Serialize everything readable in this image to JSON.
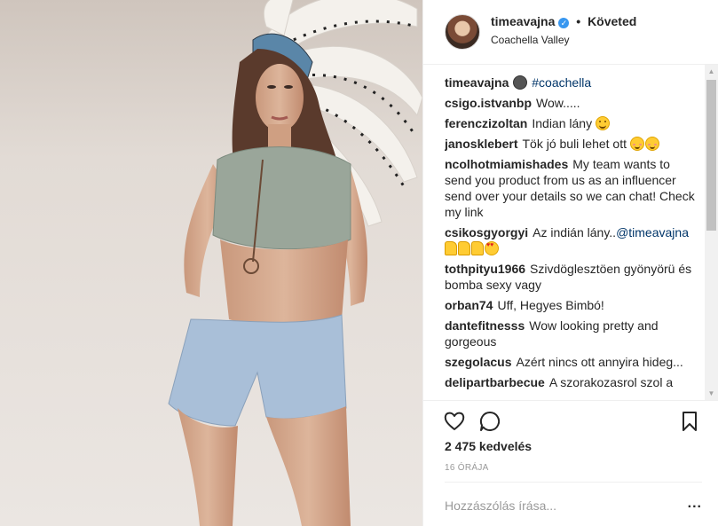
{
  "post": {
    "username": "timeavajna",
    "follow_status": "Követed",
    "location": "Coachella Valley",
    "separator": "•"
  },
  "comments": [
    {
      "user": "timeavajna",
      "emoji_before": "grim",
      "text": "",
      "mention": "#coachella"
    },
    {
      "user": "csigo.istvanbp",
      "text": "Wow....."
    },
    {
      "user": "ferenczizoltan",
      "text": "Indian lány",
      "emoji_after": "smile"
    },
    {
      "user": "janosklebert",
      "text": "Tök jó buli lehet ott",
      "emoji_after": "blush-blush"
    },
    {
      "user": "ncolhotmiamishades",
      "text": "My team wants to send you product from us as an influencer send over your details so we can chat! Check my link"
    },
    {
      "user": "csikosgyorgyi",
      "text": "Az indián lány..",
      "mention": "@timeavajna",
      "emoji_after": "thumbs-thumbs-thumbs-heart-eyes"
    },
    {
      "user": "tothpityu1966",
      "text": "Szivdöglesztöen gyönyörü és bomba sexy vagy"
    },
    {
      "user": "orban74",
      "text": "Uff, Hegyes Bimbó!"
    },
    {
      "user": "dantefitnesss",
      "text": "Wow looking pretty and gorgeous"
    },
    {
      "user": "szegolacus",
      "text": "Azért nincs ott annyira hideg..."
    },
    {
      "user": "delipartbarbecue",
      "text": "A szorakozasrol szol a"
    }
  ],
  "stats": {
    "likes": "2 475 kedvelés",
    "time": "16 ÓRÁJA"
  },
  "comment_box": {
    "placeholder": "Hozzászólás írása...",
    "more": "..."
  },
  "icons": {
    "like": "heart-outline-icon",
    "comment": "speech-bubble-icon",
    "save": "bookmark-icon",
    "verified": "verified-badge-icon"
  },
  "colors": {
    "link": "#003569",
    "verified": "#3897f0",
    "muted": "#999999"
  }
}
